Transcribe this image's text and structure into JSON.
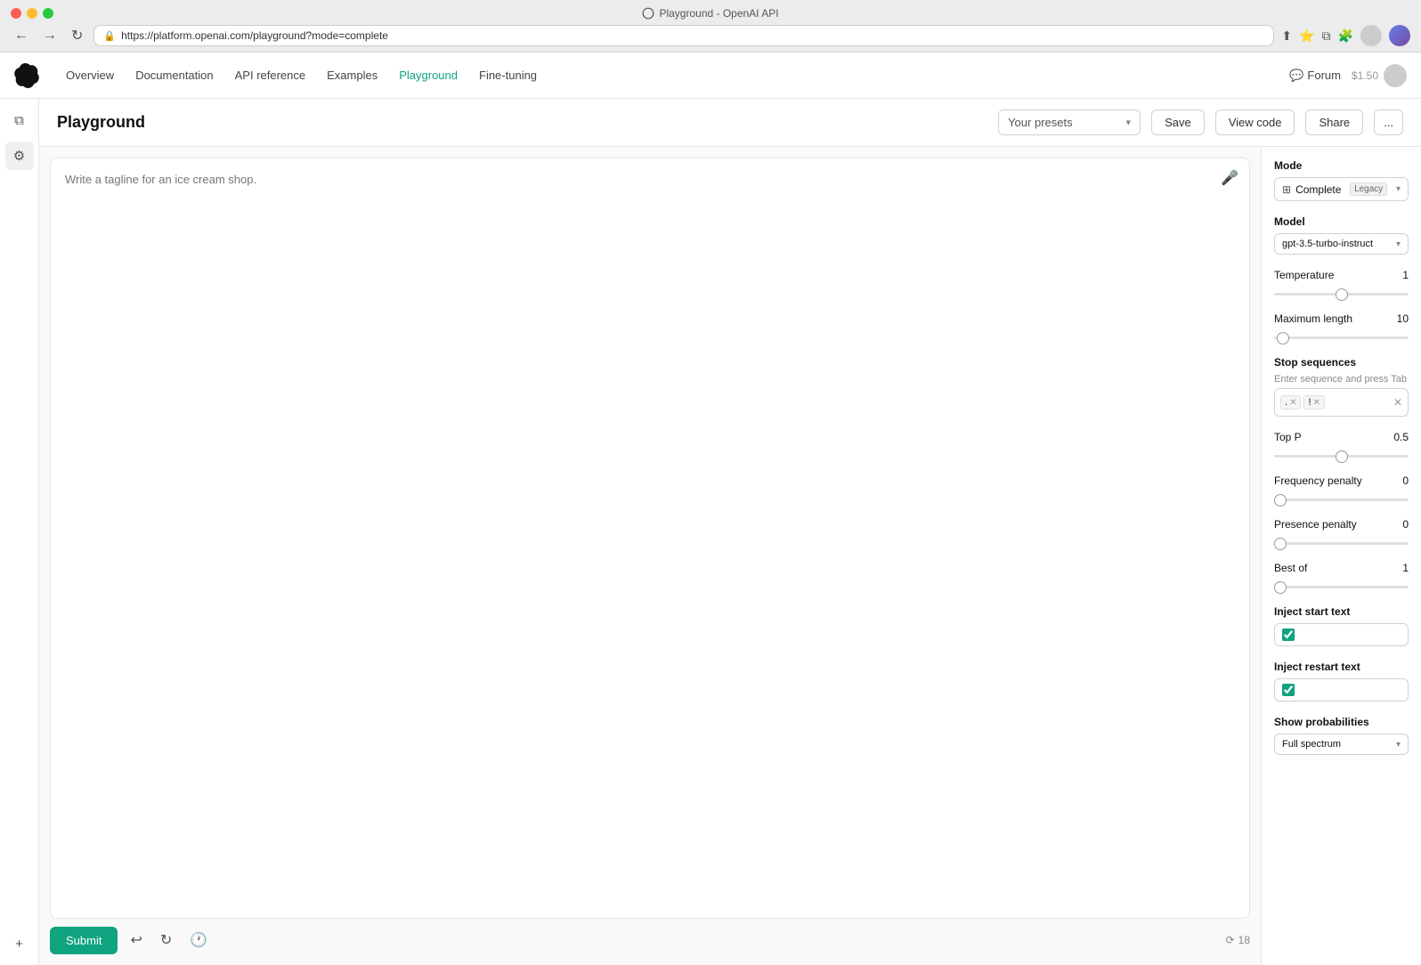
{
  "browser": {
    "title": "Playground - OpenAI API",
    "url": "https://platform.openai.com/playground?mode=complete",
    "buttons": {
      "close": "close",
      "minimize": "minimize",
      "maximize": "maximize"
    }
  },
  "nav": {
    "links": [
      {
        "label": "Overview",
        "active": false
      },
      {
        "label": "Documentation",
        "active": false
      },
      {
        "label": "API reference",
        "active": false
      },
      {
        "label": "Examples",
        "active": false
      },
      {
        "label": "Playground",
        "active": true
      },
      {
        "label": "Fine-tuning",
        "active": false
      }
    ],
    "forum": "Forum",
    "user_cost": "$1.50"
  },
  "page": {
    "title": "Playground",
    "presets_placeholder": "Your presets",
    "buttons": {
      "save": "Save",
      "view_code": "View code",
      "share": "Share",
      "more": "..."
    }
  },
  "editor": {
    "placeholder": "Write a tagline for an ice cream shop.",
    "submit": "Submit",
    "token_count": "18"
  },
  "settings": {
    "mode_label": "Mode",
    "mode_text": "Complete",
    "mode_badge": "Legacy",
    "model_label": "Model",
    "model_value": "gpt-3.5-turbo-instruct",
    "temperature_label": "Temperature",
    "temperature_value": "1",
    "temperature_slider": 50,
    "max_length_label": "Maximum length",
    "max_length_value": "10",
    "max_length_slider": 2,
    "stop_sequences_label": "Stop sequences",
    "stop_sequences_hint": "Enter sequence and press Tab",
    "stop_sequences": [
      {
        "value": ".",
        "id": "dot"
      },
      {
        "value": "!",
        "id": "exclaim"
      }
    ],
    "top_p_label": "Top P",
    "top_p_value": "0.5",
    "top_p_slider": 50,
    "freq_penalty_label": "Frequency penalty",
    "freq_penalty_value": "0",
    "freq_penalty_slider": 0,
    "presence_penalty_label": "Presence penalty",
    "presence_penalty_value": "0",
    "presence_penalty_slider": 0,
    "best_of_label": "Best of",
    "best_of_value": "1",
    "best_of_slider": 0,
    "inject_start_label": "Inject start text",
    "inject_restart_label": "Inject restart text",
    "show_prob_label": "Show probabilities",
    "show_prob_value": "Full spectrum"
  }
}
